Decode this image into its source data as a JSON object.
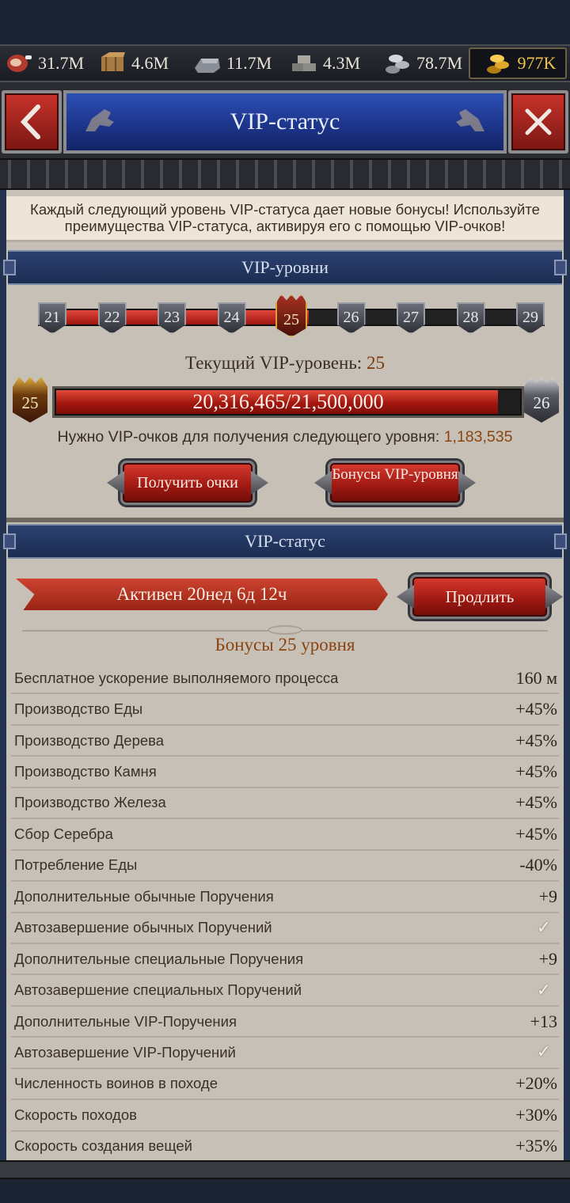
{
  "resources": [
    {
      "name": "meat-icon",
      "value": "31.7M"
    },
    {
      "name": "wood-icon",
      "value": "4.6M"
    },
    {
      "name": "stone-icon",
      "value": "11.7M"
    },
    {
      "name": "iron-icon",
      "value": "4.3M"
    },
    {
      "name": "silver-icon",
      "value": "78.7M"
    }
  ],
  "gold": {
    "value": "977K"
  },
  "header": {
    "title": "VIP-статус"
  },
  "intro": "Каждый следующий уровень VIP-статуса дает новые бонусы! Используйте преимущества VIP-статуса, активируя его с помощью VIP-очков!",
  "levels_section": {
    "title": "VIP-уровни",
    "nodes": [
      "21",
      "22",
      "23",
      "24",
      "25",
      "26",
      "27",
      "28",
      "29"
    ],
    "current_index": 4,
    "current_label": "Текущий VIP-уровень: ",
    "current_value": "25",
    "badge_current": "25",
    "badge_next": "26",
    "progress_text": "20,316,465/21,500,000",
    "progress_fraction": 0.945,
    "need_label": "Нужно VIP-очков для получения следующего уровня: ",
    "need_value": "1,183,535",
    "get_points_label": "Получить очки",
    "bonuses_label": "Бонусы VIP-уровня"
  },
  "status_section": {
    "title": "VIP-статус",
    "active_text": "Активен 20нед 6д 12ч",
    "extend_label": "Продлить",
    "bonus_title": "Бонусы 25 уровня"
  },
  "bonuses": [
    {
      "label": "Бесплатное ускорение выполняемого процесса",
      "value": "160 м"
    },
    {
      "label": "Производство Еды",
      "value": "+45%"
    },
    {
      "label": "Производство Дерева",
      "value": "+45%"
    },
    {
      "label": "Производство Камня",
      "value": "+45%"
    },
    {
      "label": "Производство Железа",
      "value": "+45%"
    },
    {
      "label": "Сбор Серебра",
      "value": "+45%"
    },
    {
      "label": "Потребление Еды",
      "value": "-40%"
    },
    {
      "label": "Дополнительные обычные Поручения",
      "value": "+9"
    },
    {
      "label": "Автозавершение обычных Поручений",
      "value": "✓"
    },
    {
      "label": "Дополнительные специальные Поручения",
      "value": "+9"
    },
    {
      "label": "Автозавершение специальных Поручений",
      "value": "✓"
    },
    {
      "label": "Дополнительные VIP-Поручения",
      "value": "+13"
    },
    {
      "label": "Автозавершение VIP-Поручений",
      "value": "✓"
    },
    {
      "label": "Численность воинов в походе",
      "value": "+20%"
    },
    {
      "label": "Скорость походов",
      "value": "+30%"
    },
    {
      "label": "Скорость создания вещей",
      "value": "+35%"
    }
  ]
}
